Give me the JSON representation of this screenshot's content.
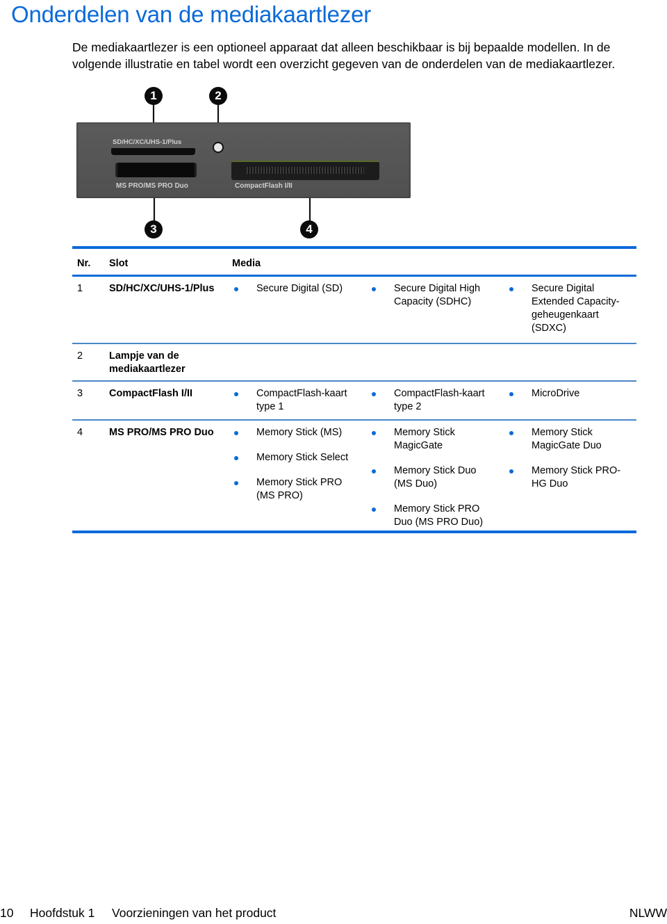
{
  "page_title": "Onderdelen van de mediakaartlezer",
  "intro": "De mediakaartlezer is een optioneel apparaat dat alleen beschikbaar is bij bepaalde modellen. In de volgende illustratie en tabel wordt een overzicht gegeven van de onderdelen van de mediakaartlezer.",
  "illustration": {
    "labels": {
      "sd_slot": "SD/HC/XC/UHS-1/Plus",
      "ms_slot": "MS PRO/MS PRO Duo",
      "cf_slot": "CompactFlash I/II"
    },
    "callouts": [
      "1",
      "2",
      "3",
      "4"
    ]
  },
  "table": {
    "headers": {
      "nr": "Nr.",
      "slot": "Slot",
      "media": "Media"
    },
    "rows": [
      {
        "nr": "1",
        "slot": "SD/HC/XC/UHS-1/Plus",
        "media": [
          [
            "Secure Digital (SD)"
          ],
          [
            "Secure Digital High Capacity (SDHC)"
          ],
          [
            "Secure Digital Extended Capacity-geheugenkaart (SDXC)"
          ]
        ]
      },
      {
        "nr": "2",
        "slot": "Lampje van de mediakaartlezer",
        "media": [
          [],
          [],
          []
        ]
      },
      {
        "nr": "3",
        "slot": "CompactFlash I/II",
        "media": [
          [
            "CompactFlash-kaart type 1"
          ],
          [
            "CompactFlash-kaart type 2"
          ],
          [
            "MicroDrive"
          ]
        ]
      },
      {
        "nr": "4",
        "slot": "MS PRO/MS PRO Duo",
        "media": [
          [
            "Memory Stick (MS)",
            "Memory Stick Select",
            "Memory Stick PRO (MS PRO)"
          ],
          [
            "Memory Stick MagicGate",
            "Memory Stick Duo (MS Duo)",
            "Memory Stick PRO Duo (MS PRO Duo)"
          ],
          [
            "Memory Stick MagicGate Duo",
            "Memory Stick PRO-HG Duo"
          ]
        ]
      }
    ]
  },
  "footer": {
    "page_number": "10",
    "chapter": "Hoofdstuk 1",
    "chapter_title": "Voorzieningen van het product",
    "locale_code": "NLWW"
  },
  "colors": {
    "accent": "#0a6ad8",
    "panel": "#555555"
  }
}
